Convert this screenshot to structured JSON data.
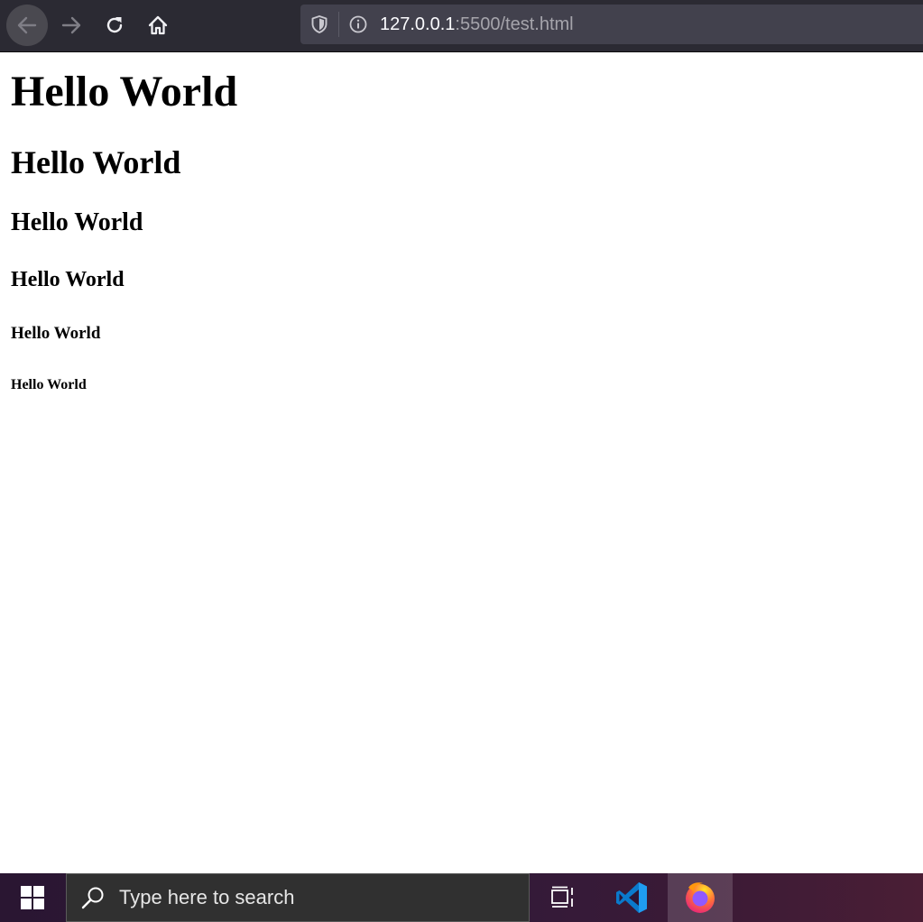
{
  "browser": {
    "toolbar": {
      "back_icon": "back-arrow-icon",
      "forward_icon": "forward-arrow-icon",
      "reload_icon": "reload-icon",
      "home_icon": "home-icon"
    },
    "urlbar": {
      "host": "127.0.0.1",
      "rest": ":5500/test.html",
      "shield_icon": "tracking-protection-shield-icon",
      "info_icon": "site-info-icon"
    }
  },
  "page": {
    "h1": "Hello World",
    "h2": "Hello World",
    "h3": "Hello World",
    "h4": "Hello World",
    "h5": "Hello World",
    "h6": "Hello World"
  },
  "taskbar": {
    "search_placeholder": "Type here to search",
    "apps": [
      "Task View",
      "Visual Studio Code",
      "Firefox"
    ],
    "colors": {
      "vscode_blue": "#0a7acc",
      "firefox_orange": "#ff7139",
      "firefox_purple": "#9059ff"
    }
  }
}
